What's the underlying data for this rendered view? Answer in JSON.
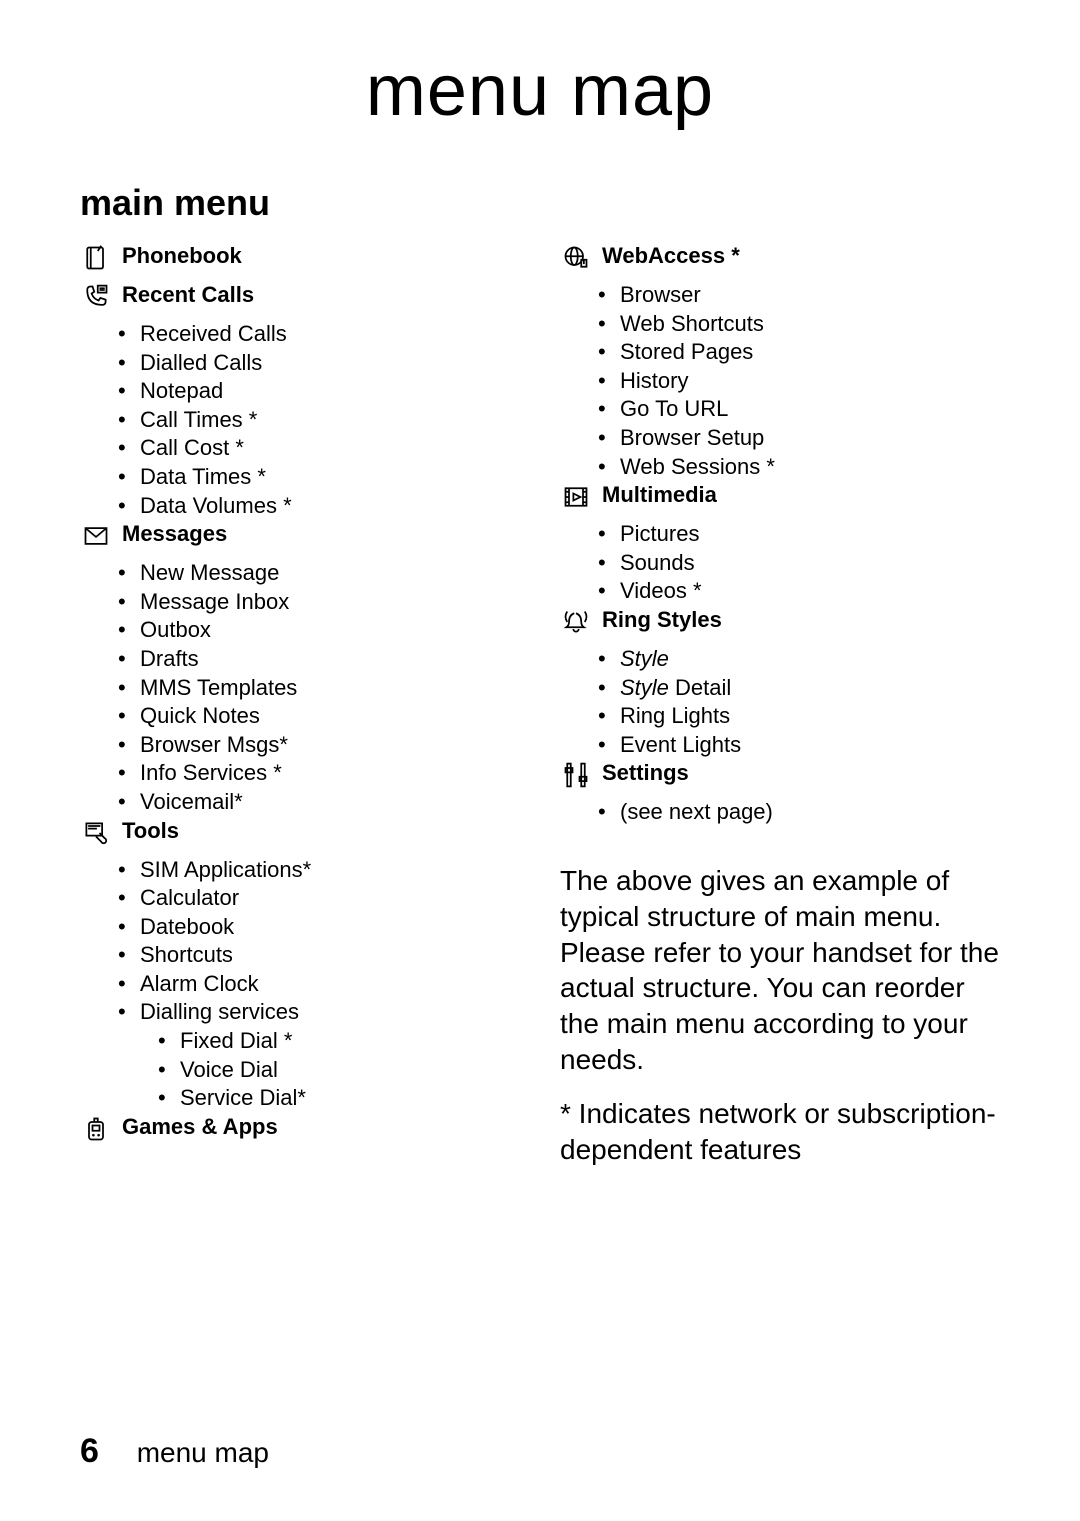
{
  "title": "menu map",
  "section": "main menu",
  "left": [
    {
      "heading": "Phonebook",
      "items": []
    },
    {
      "heading": "Recent Calls",
      "items": [
        {
          "t": "Received Calls"
        },
        {
          "t": "Dialled Calls"
        },
        {
          "t": "Notepad"
        },
        {
          "t": "Call Times *"
        },
        {
          "t": "Call Cost *"
        },
        {
          "t": "Data Times *"
        },
        {
          "t": "Data Volumes *"
        }
      ]
    },
    {
      "heading": "Messages",
      "items": [
        {
          "t": "New Message"
        },
        {
          "t": "Message Inbox"
        },
        {
          "t": "Outbox"
        },
        {
          "t": "Drafts"
        },
        {
          "t": "MMS Templates"
        },
        {
          "t": "Quick Notes"
        },
        {
          "t": "Browser Msgs*"
        },
        {
          "t": "Info Services *"
        },
        {
          "t": "Voicemail*"
        }
      ]
    },
    {
      "heading": "Tools",
      "items": [
        {
          "t": "SIM Applications*"
        },
        {
          "t": "Calculator"
        },
        {
          "t": "Datebook"
        },
        {
          "t": "Shortcuts"
        },
        {
          "t": "Alarm Clock"
        },
        {
          "t": "Dialling services",
          "sub": [
            {
              "t": "Fixed Dial *"
            },
            {
              "t": "Voice Dial"
            },
            {
              "t": "Service Dial*"
            }
          ]
        }
      ]
    },
    {
      "heading": "Games & Apps",
      "items": []
    }
  ],
  "right": [
    {
      "heading": "WebAccess *",
      "items": [
        {
          "t": "Browser"
        },
        {
          "t": "Web Shortcuts"
        },
        {
          "t": "Stored Pages"
        },
        {
          "t": "History"
        },
        {
          "t": "Go To URL"
        },
        {
          "t": "Browser Setup"
        },
        {
          "t": "Web Sessions *"
        }
      ]
    },
    {
      "heading": "Multimedia",
      "items": [
        {
          "t": "Pictures"
        },
        {
          "t": "Sounds"
        },
        {
          "t": "Videos *"
        }
      ]
    },
    {
      "heading": "Ring Styles",
      "items": [
        {
          "t": "Style",
          "italic": true
        },
        {
          "t": "Style Detail",
          "italicPrefix": "Style",
          "suffix": " Detail"
        },
        {
          "t": "Ring Lights"
        },
        {
          "t": "Event Lights"
        }
      ]
    },
    {
      "heading": "Settings",
      "items": [
        {
          "t": "(see next page)"
        }
      ]
    }
  ],
  "paragraph1": "The above gives an example of typical structure of main menu. Please refer to your handset for the actual structure. You can reorder the main menu according to your needs.",
  "paragraph2": "* Indicates network or subscription-dependent features",
  "pageNumber": "6",
  "footerLabel": "menu map",
  "icons": {
    "left": [
      "phonebook",
      "recent-calls",
      "messages",
      "tools",
      "games"
    ],
    "right": [
      "webaccess",
      "multimedia",
      "ringstyles",
      "settings"
    ]
  }
}
